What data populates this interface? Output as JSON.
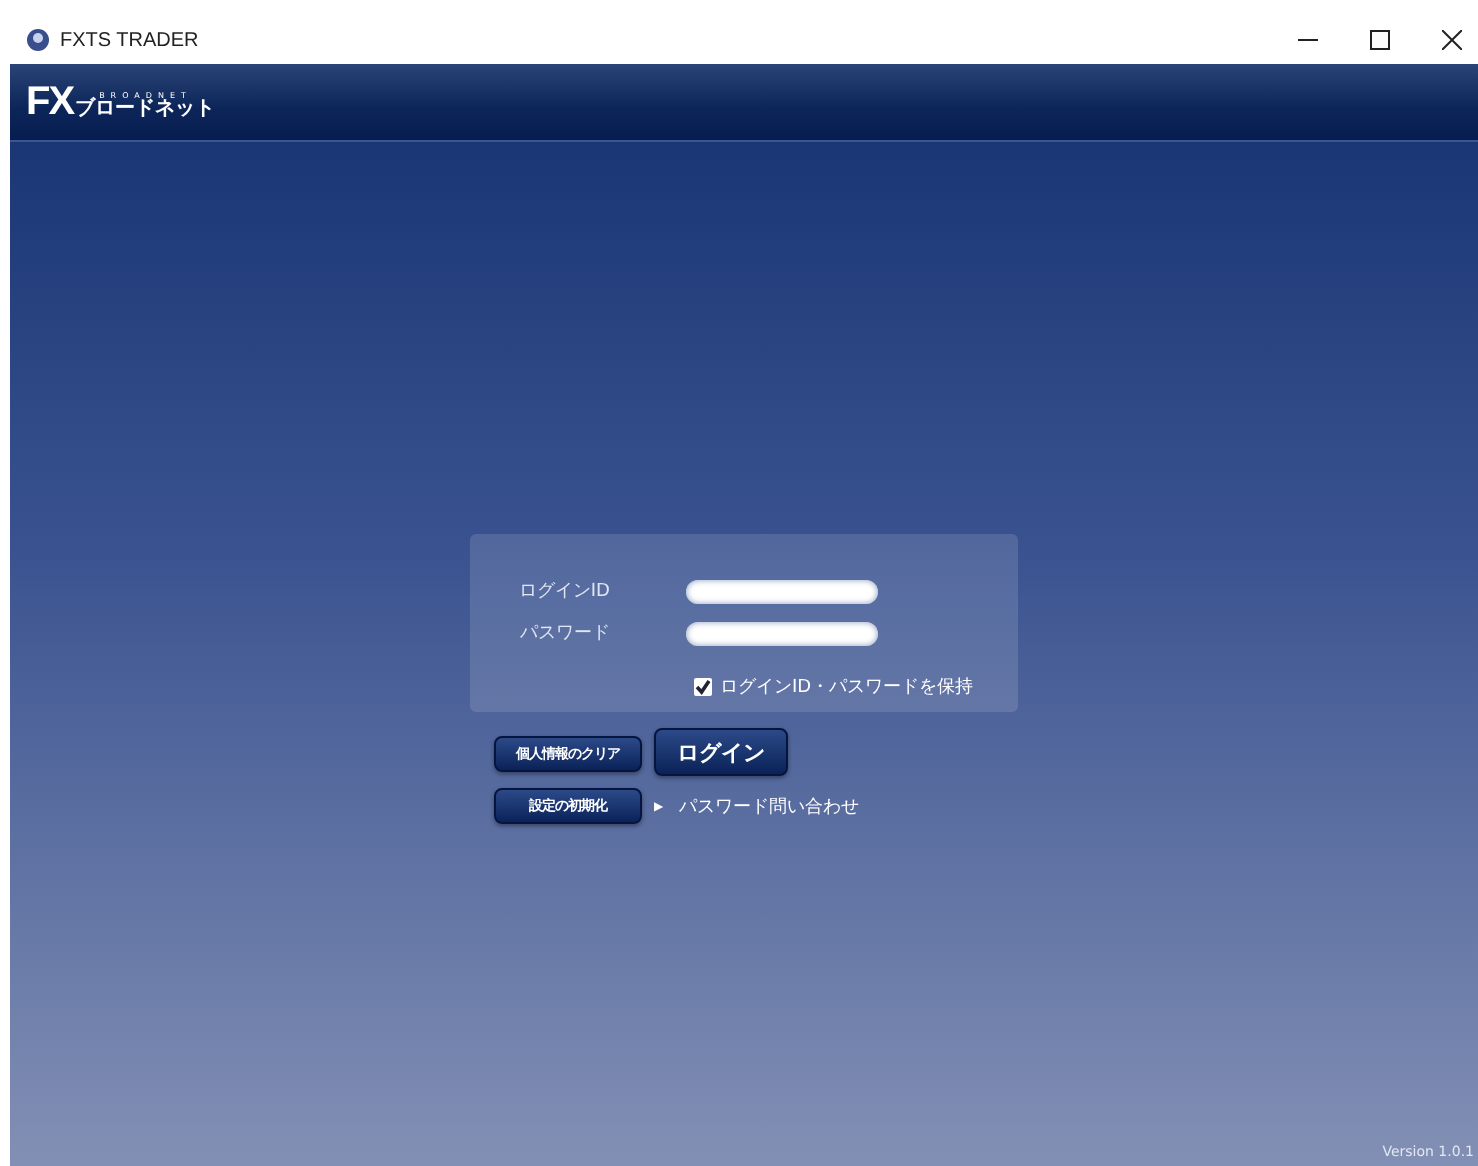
{
  "window": {
    "title": "FXTS TRADER"
  },
  "logo": {
    "main": "FX",
    "sub": "ブロードネット",
    "small": "BROADNET"
  },
  "login_form": {
    "id_label": "ログインID",
    "password_label": "パスワード",
    "remember": {
      "label": "ログインID・パスワードを保持",
      "checked": true
    }
  },
  "buttons": {
    "clear": "個人情報のクリア",
    "login": "ログイン",
    "reset": "設定の初期化"
  },
  "password_inquiry": {
    "marker": "▶",
    "label": "パスワード問い合わせ"
  },
  "version": "Version 1.0.1"
}
